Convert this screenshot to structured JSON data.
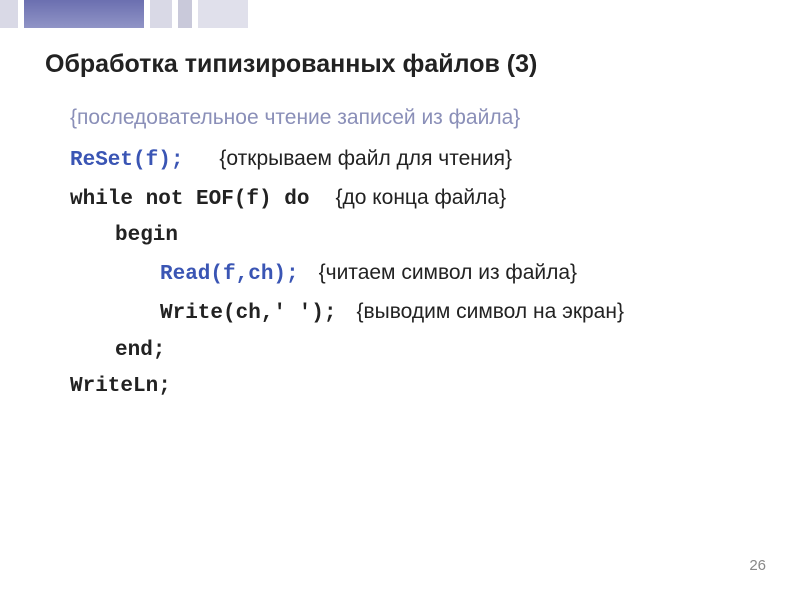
{
  "slide": {
    "title": "Обработка типизированных файлов (3)",
    "page_number": "26"
  },
  "code": {
    "header_comment": "{последовательное чтение записей из файла}",
    "line1_code": "ReSet(f);",
    "line1_comment": "{открываем файл для чтения}",
    "line2_code": "while not EOF(f) do",
    "line2_comment": "{до конца файла}",
    "line3_code": "begin",
    "line4_code": "Read(f,ch);",
    "line4_comment": "{читаем символ из файла}",
    "line5_code": "Write(ch,' ');",
    "line5_comment": "{выводим символ на экран}",
    "line6_code": "end;",
    "line7_code": "WriteLn;"
  }
}
